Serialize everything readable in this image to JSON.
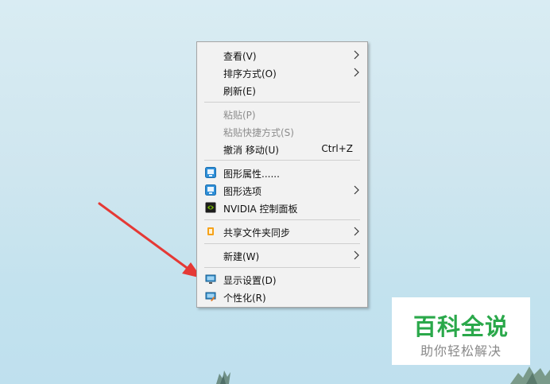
{
  "menu": {
    "items": [
      {
        "label": "查看(V)"
      },
      {
        "label": "排序方式(O)"
      },
      {
        "label": "刷新(E)"
      },
      {
        "label": "粘贴(P)"
      },
      {
        "label": "粘贴快捷方式(S)"
      },
      {
        "label": "撤消 移动(U)",
        "shortcut": "Ctrl+Z"
      },
      {
        "label": "图形属性......"
      },
      {
        "label": "图形选项"
      },
      {
        "label": "NVIDIA 控制面板"
      },
      {
        "label": "共享文件夹同步"
      },
      {
        "label": "新建(W)"
      },
      {
        "label": "显示设置(D)"
      },
      {
        "label": "个性化(R)"
      }
    ]
  },
  "watermark": {
    "title": "百科全说",
    "subtitle": "助你轻松解决"
  },
  "colors": {
    "accent_arrow": "#e53935",
    "watermark_green": "#2aa84a",
    "menu_bg": "#f2f2f2"
  }
}
